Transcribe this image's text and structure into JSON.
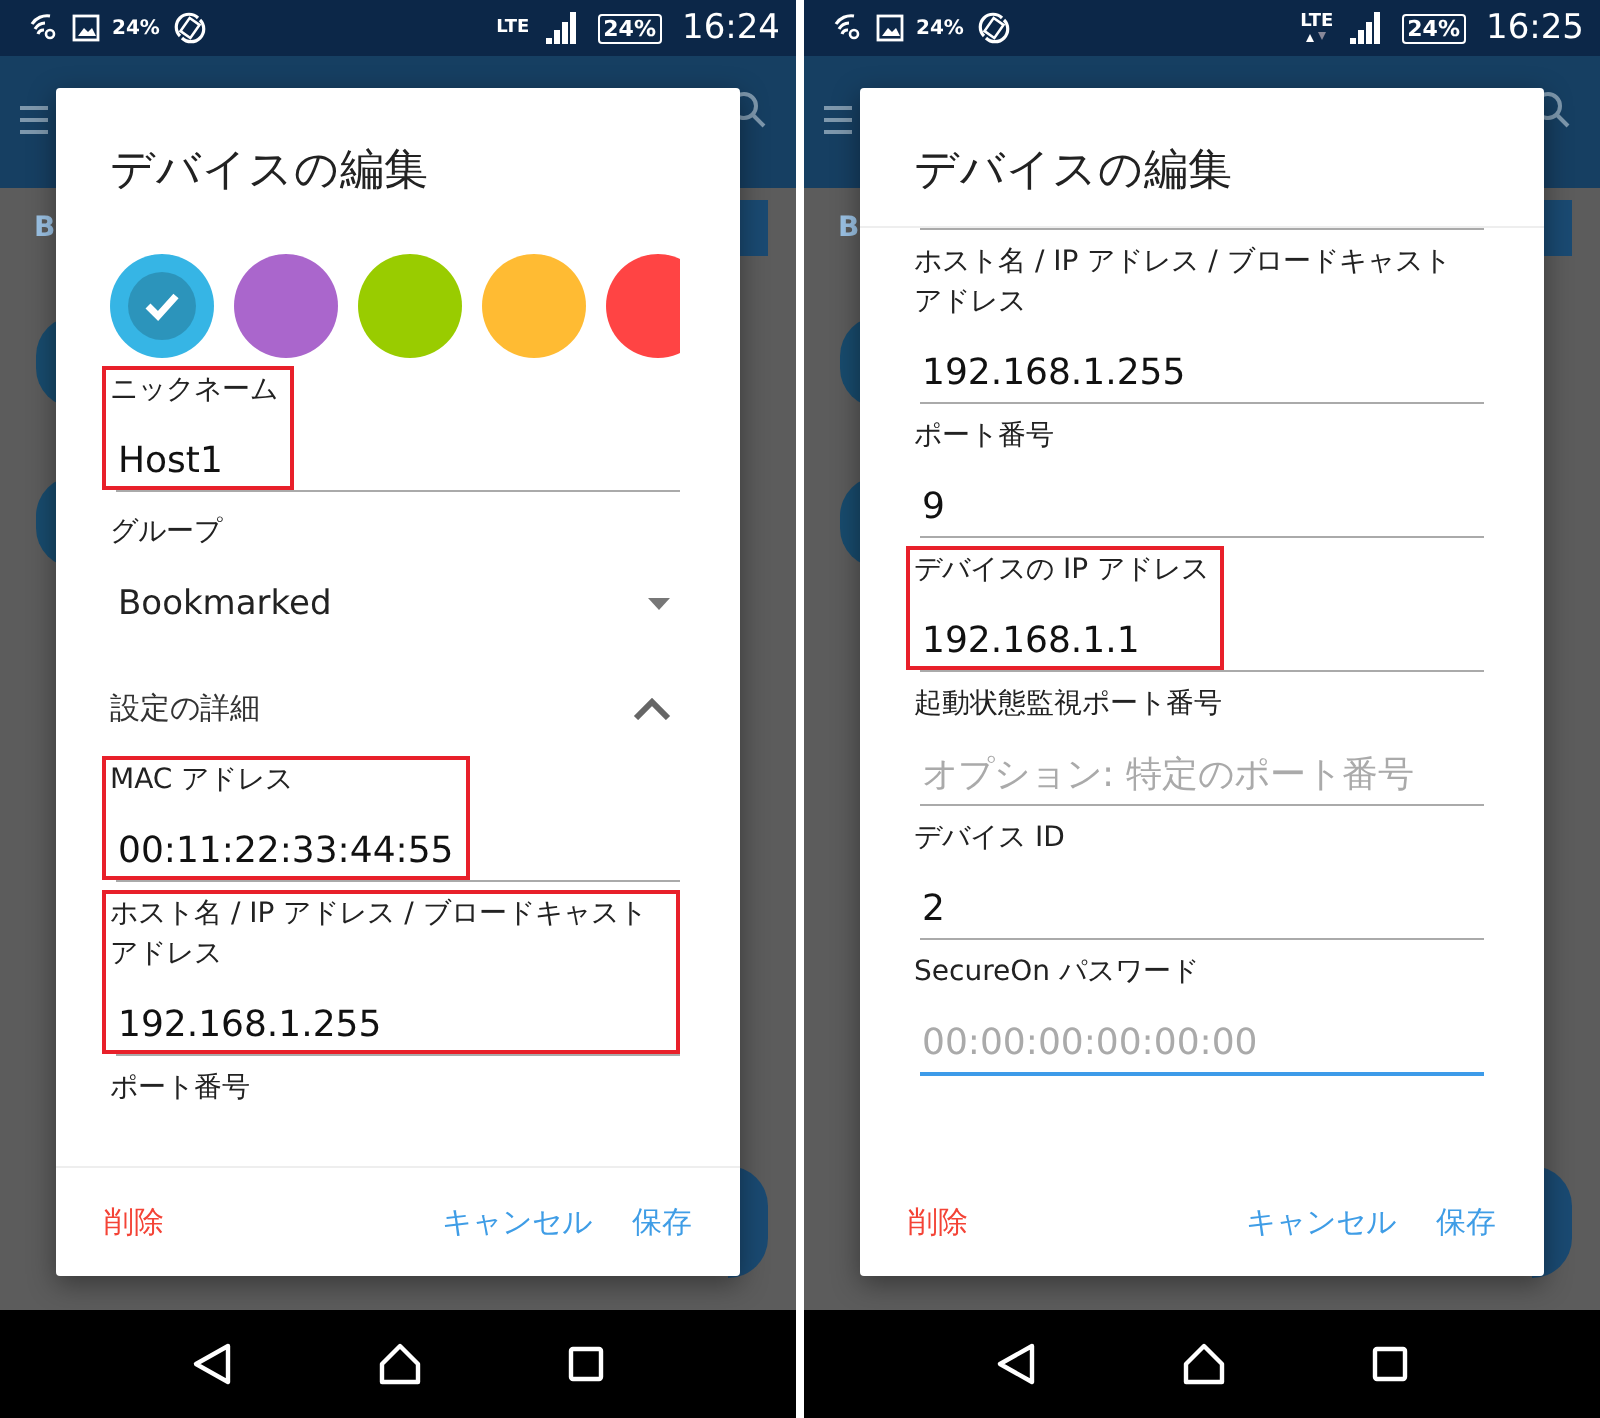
{
  "screens": [
    {
      "status_bar": {
        "left_text": "24%",
        "network": "LTE",
        "data_activity": false,
        "battery": "24%",
        "time": "16:24"
      },
      "background": {
        "label": "B"
      },
      "dialog": {
        "title": "デバイスの編集",
        "scrolled": false,
        "colors": [
          {
            "color": "#36b5e5",
            "selected": true
          },
          {
            "color": "#aa66cc",
            "selected": false
          },
          {
            "color": "#99cc00",
            "selected": false
          },
          {
            "color": "#ffbb33",
            "selected": false
          },
          {
            "color": "#ff4444",
            "selected": false
          }
        ],
        "fields": [
          {
            "kind": "text",
            "label": "ニックネーム",
            "value": "Host1",
            "highlighted": true
          },
          {
            "kind": "dropdown",
            "label": "グループ",
            "value": "Bookmarked"
          },
          {
            "kind": "section",
            "label": "設定の詳細",
            "expanded": true
          },
          {
            "kind": "text",
            "label": "MAC アドレス",
            "value": "00:11:22:33:44:55",
            "highlighted": true
          },
          {
            "kind": "text",
            "label": "ホスト名 / IP アドレス / ブロードキャストアドレス",
            "value": "192.168.1.255",
            "highlighted": true
          },
          {
            "kind": "text",
            "label": "ポート番号"
          }
        ],
        "actions": [
          {
            "label": "削除",
            "kind": "danger"
          },
          {
            "label": "キャンセル",
            "kind": "normal"
          },
          {
            "label": "保存",
            "kind": "normal"
          }
        ]
      }
    },
    {
      "status_bar": {
        "left_text": "24%",
        "network": "LTE",
        "data_activity": true,
        "battery": "24%",
        "time": "16:25"
      },
      "background": {
        "label": "B"
      },
      "dialog": {
        "title": "デバイスの編集",
        "scrolled": true,
        "fields": [
          {
            "kind": "text",
            "label": "ホスト名 / IP アドレス / ブロードキャストアドレス",
            "value": "192.168.1.255",
            "highlighted": false
          },
          {
            "kind": "text",
            "label": "ポート番号",
            "value": "9",
            "highlighted": false
          },
          {
            "kind": "text",
            "label": "デバイスの IP アドレス",
            "value": "192.168.1.1",
            "highlighted": true
          },
          {
            "kind": "text",
            "label": "起動状態監視ポート番号",
            "placeholder": "オプション: 特定のポート番号",
            "highlighted": false
          },
          {
            "kind": "text",
            "label": "デバイス ID",
            "value": "2",
            "highlighted": false
          },
          {
            "kind": "text",
            "label": "SecureOn パスワード",
            "placeholder": "00:00:00:00:00:00",
            "highlighted": false,
            "focused": true
          }
        ],
        "actions": [
          {
            "label": "削除",
            "kind": "danger"
          },
          {
            "label": "キャンセル",
            "kind": "normal"
          },
          {
            "label": "保存",
            "kind": "normal"
          }
        ]
      }
    }
  ]
}
